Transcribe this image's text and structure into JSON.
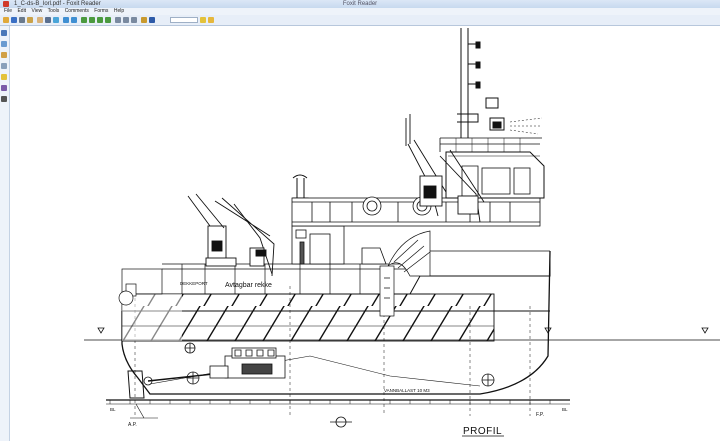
{
  "window": {
    "title": "1_C-ds-B_Iorl.pdf - Foxit Reader",
    "center_caption": "Foxit Reader"
  },
  "menu": [
    "File",
    "Edit",
    "View",
    "Tools",
    "Comments",
    "Forms",
    "Help"
  ],
  "toolbar": {
    "zoom_value": "",
    "buttons": [
      {
        "name": "open-icon",
        "color": "#e0a93a"
      },
      {
        "name": "save-icon",
        "color": "#3a6fc4"
      },
      {
        "name": "print-icon",
        "color": "#6a7a8c"
      },
      {
        "name": "email-icon",
        "color": "#caa24a"
      },
      {
        "name": "hand-tool-icon",
        "color": "#d8b27a"
      },
      {
        "name": "select-text-icon",
        "color": "#5a6f8f"
      },
      {
        "name": "snapshot-icon",
        "color": "#4aa5d8"
      },
      {
        "name": "zoom-in-icon",
        "color": "#3f8fd2"
      },
      {
        "name": "zoom-out-icon",
        "color": "#3f8fd2"
      },
      {
        "name": "first-page-icon",
        "color": "#4b9a3f"
      },
      {
        "name": "prev-page-icon",
        "color": "#4b9a3f"
      },
      {
        "name": "next-page-icon",
        "color": "#4b9a3f"
      },
      {
        "name": "last-page-icon",
        "color": "#4b9a3f"
      },
      {
        "name": "rotate-icon",
        "color": "#7a8aa0"
      },
      {
        "name": "fit-page-icon",
        "color": "#7a8aa0"
      },
      {
        "name": "fit-width-icon",
        "color": "#7a8aa0"
      },
      {
        "name": "find-icon",
        "color": "#c99a2e"
      },
      {
        "name": "typewriter-icon",
        "color": "#2d5aa8"
      },
      {
        "name": "note-icon",
        "color": "#e3c23a"
      },
      {
        "name": "highlight-icon",
        "color": "#e6b73c"
      }
    ]
  },
  "left_tools": [
    "bookmarks-icon",
    "pages-icon",
    "layers-icon",
    "attachments-icon",
    "comments-icon",
    "signature-icon",
    "pen-icon"
  ],
  "drawing": {
    "labels": {
      "profile": "PROFIL",
      "railing": "Avtagbar rekke",
      "door": "DEKKEPORT",
      "ballast": "VANNBALLAST 10 M3",
      "aft_perpendicular": "A.P.",
      "fore_perpendicular": "F.P.",
      "baseline_left": "BL",
      "baseline_right": "BL"
    }
  }
}
